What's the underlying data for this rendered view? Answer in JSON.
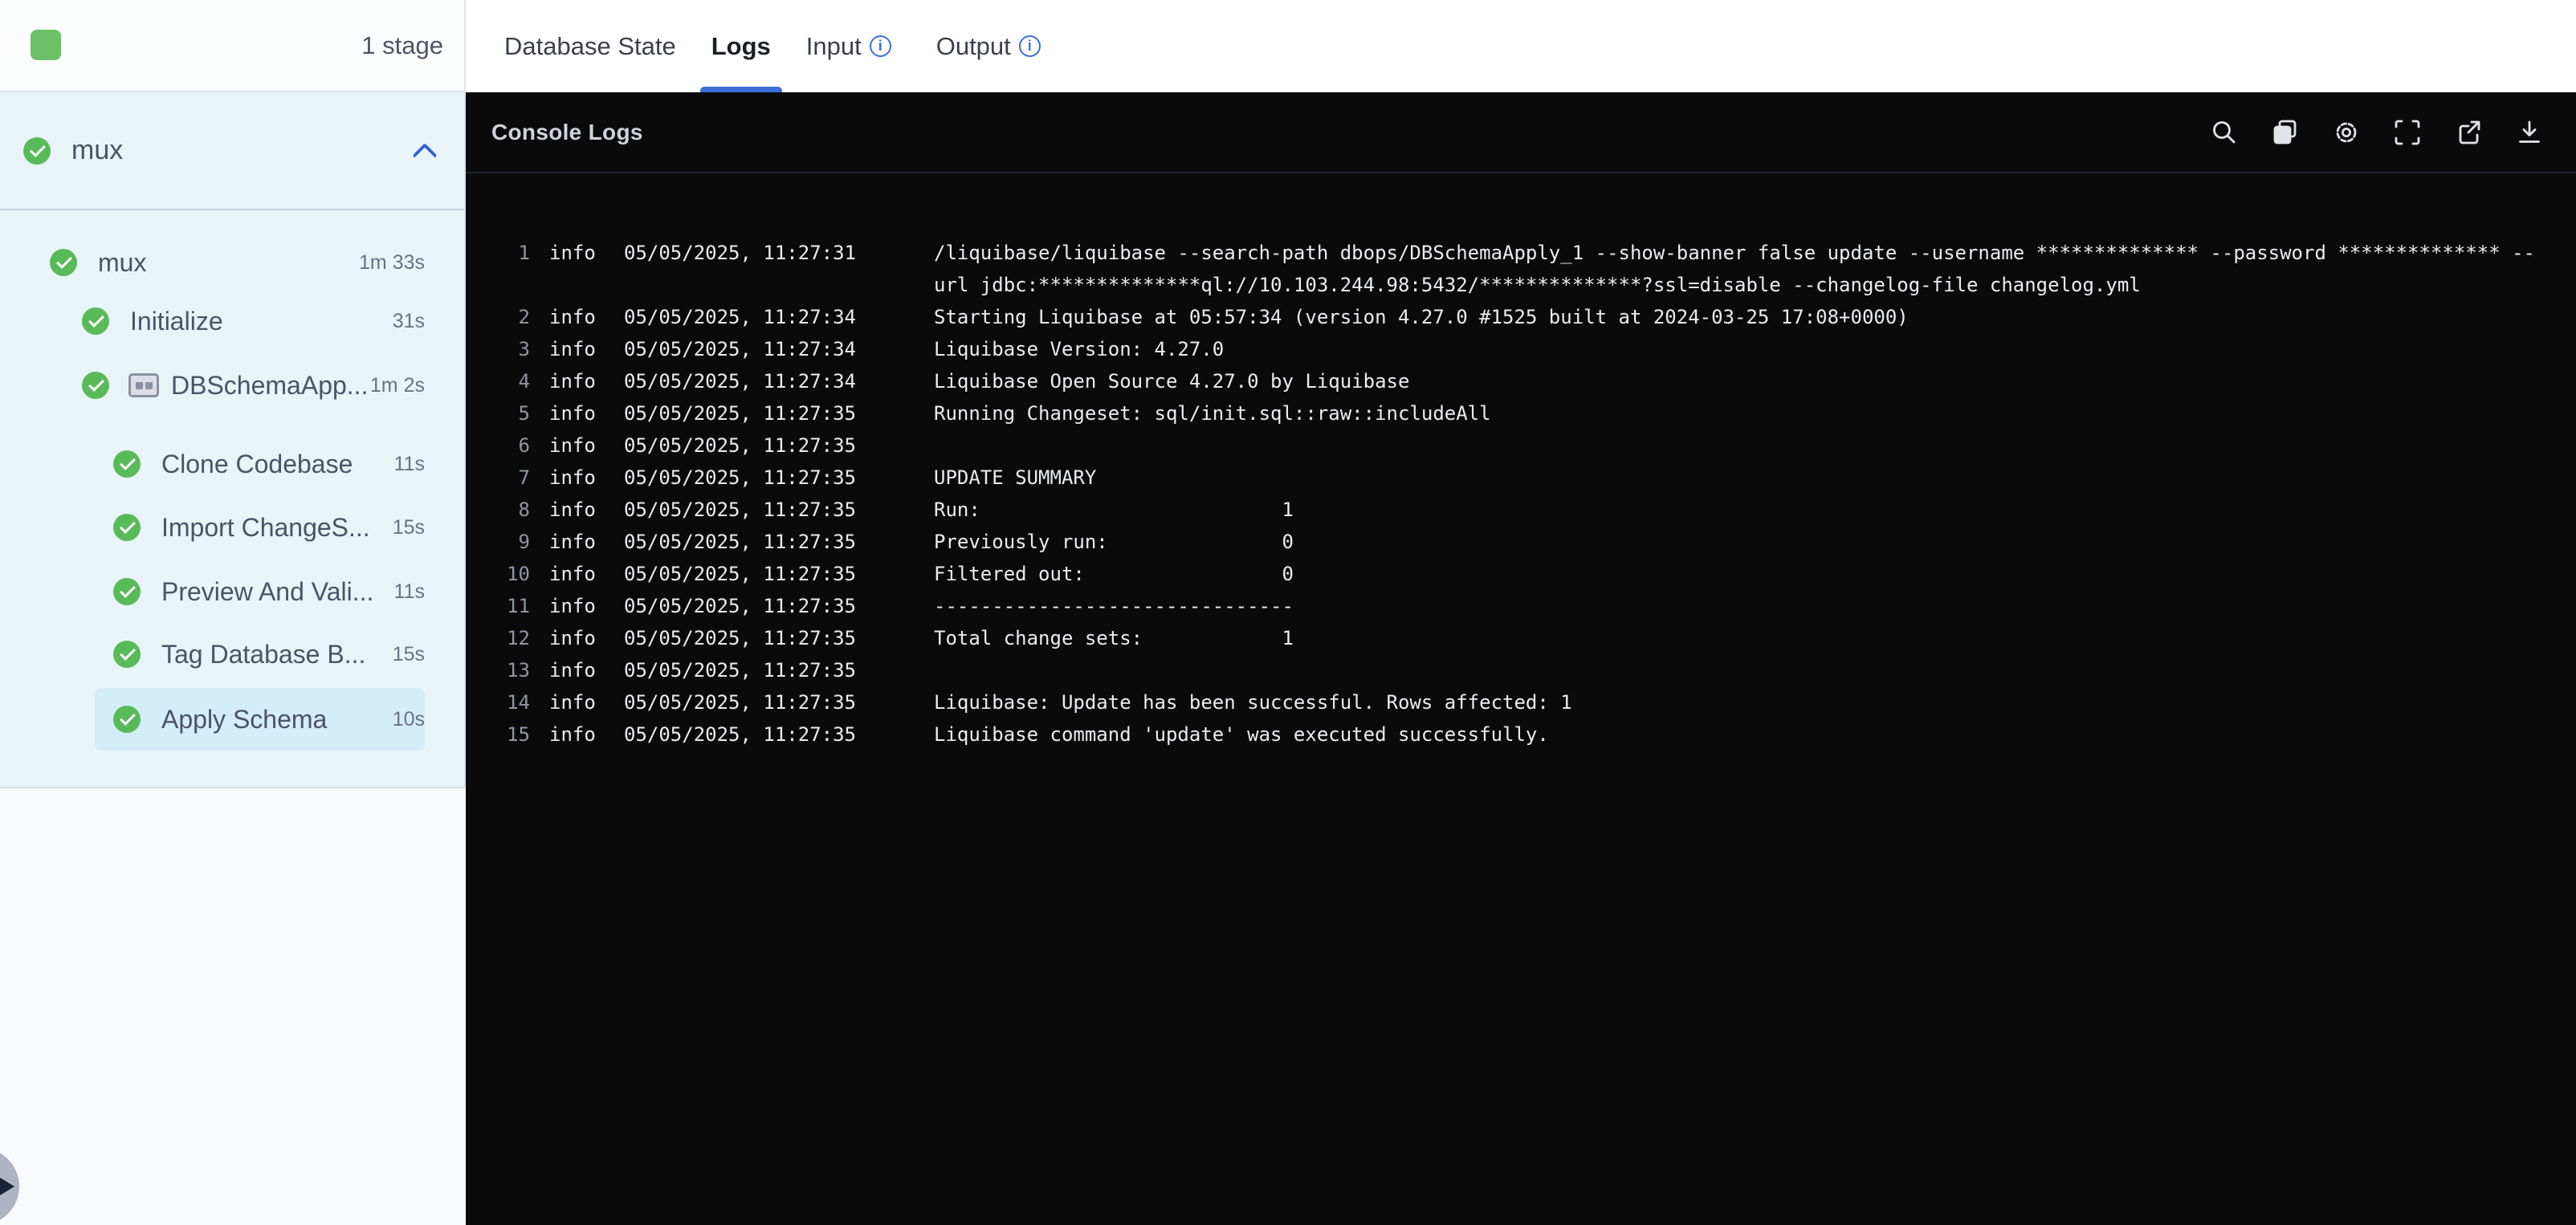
{
  "header": {
    "stage_count_label": "1 stage"
  },
  "tabs": [
    {
      "label": "Database State",
      "active": false,
      "info": false
    },
    {
      "label": "Logs",
      "active": true,
      "info": false
    },
    {
      "label": "Input",
      "active": false,
      "info": true
    },
    {
      "label": "Output",
      "active": false,
      "info": true
    }
  ],
  "sidebar": {
    "group": {
      "label": "mux",
      "status": "success"
    },
    "steps": [
      {
        "label": "mux",
        "duration": "1m 33s",
        "indent": 1,
        "status": "success",
        "selected": false,
        "group_icon": false
      },
      {
        "label": "Initialize",
        "duration": "31s",
        "indent": 2,
        "status": "success",
        "selected": false,
        "group_icon": false
      },
      {
        "label": "DBSchemaApp...",
        "duration": "1m 2s",
        "indent": 2,
        "status": "success",
        "selected": false,
        "group_icon": true
      },
      {
        "label": "Clone Codebase",
        "duration": "11s",
        "indent": 3,
        "status": "success",
        "selected": false,
        "group_icon": false
      },
      {
        "label": "Import ChangeS...",
        "duration": "15s",
        "indent": 3,
        "status": "success",
        "selected": false,
        "group_icon": false
      },
      {
        "label": "Preview And Vali...",
        "duration": "11s",
        "indent": 3,
        "status": "success",
        "selected": false,
        "group_icon": false
      },
      {
        "label": "Tag Database B...",
        "duration": "15s",
        "indent": 3,
        "status": "success",
        "selected": false,
        "group_icon": false
      },
      {
        "label": "Apply Schema",
        "duration": "10s",
        "indent": 3,
        "status": "success",
        "selected": true,
        "group_icon": false
      }
    ]
  },
  "console": {
    "title": "Console Logs",
    "toolbar_icons": [
      "search",
      "copy",
      "settings",
      "fullscreen",
      "open-in-new",
      "download"
    ],
    "logs": [
      {
        "n": "1",
        "level": "info",
        "ts": "05/05/2025, 11:27:31",
        "msg": "/liquibase/liquibase --search-path dbops/DBSchemaApply_1 --show-banner false update --username ************** --password ************** --\nurl jdbc:**************ql://10.103.244.98:5432/**************?ssl=disable --changelog-file changelog.yml"
      },
      {
        "n": "2",
        "level": "info",
        "ts": "05/05/2025, 11:27:34",
        "msg": "Starting Liquibase at 05:57:34 (version 4.27.0 #1525 built at 2024-03-25 17:08+0000)"
      },
      {
        "n": "3",
        "level": "info",
        "ts": "05/05/2025, 11:27:34",
        "msg": "Liquibase Version: 4.27.0"
      },
      {
        "n": "4",
        "level": "info",
        "ts": "05/05/2025, 11:27:34",
        "msg": "Liquibase Open Source 4.27.0 by Liquibase"
      },
      {
        "n": "5",
        "level": "info",
        "ts": "05/05/2025, 11:27:35",
        "msg": "Running Changeset: sql/init.sql::raw::includeAll"
      },
      {
        "n": "6",
        "level": "info",
        "ts": "05/05/2025, 11:27:35",
        "msg": ""
      },
      {
        "n": "7",
        "level": "info",
        "ts": "05/05/2025, 11:27:35",
        "msg": "UPDATE SUMMARY"
      },
      {
        "n": "8",
        "level": "info",
        "ts": "05/05/2025, 11:27:35",
        "msg": "Run:                          1"
      },
      {
        "n": "9",
        "level": "info",
        "ts": "05/05/2025, 11:27:35",
        "msg": "Previously run:               0"
      },
      {
        "n": "10",
        "level": "info",
        "ts": "05/05/2025, 11:27:35",
        "msg": "Filtered out:                 0"
      },
      {
        "n": "11",
        "level": "info",
        "ts": "05/05/2025, 11:27:35",
        "msg": "-------------------------------"
      },
      {
        "n": "12",
        "level": "info",
        "ts": "05/05/2025, 11:27:35",
        "msg": "Total change sets:            1"
      },
      {
        "n": "13",
        "level": "info",
        "ts": "05/05/2025, 11:27:35",
        "msg": ""
      },
      {
        "n": "14",
        "level": "info",
        "ts": "05/05/2025, 11:27:35",
        "msg": "Liquibase: Update has been successful. Rows affected: 1"
      },
      {
        "n": "15",
        "level": "info",
        "ts": "05/05/2025, 11:27:35",
        "msg": "Liquibase command 'update' was executed successfully."
      }
    ]
  },
  "colors": {
    "accent_blue": "#3a6fd8",
    "success_green": "#59ba59",
    "sidebar_bg": "#e9f4f9",
    "selected_row_bg": "#d3edf9",
    "console_bg": "#0a0a0b"
  }
}
